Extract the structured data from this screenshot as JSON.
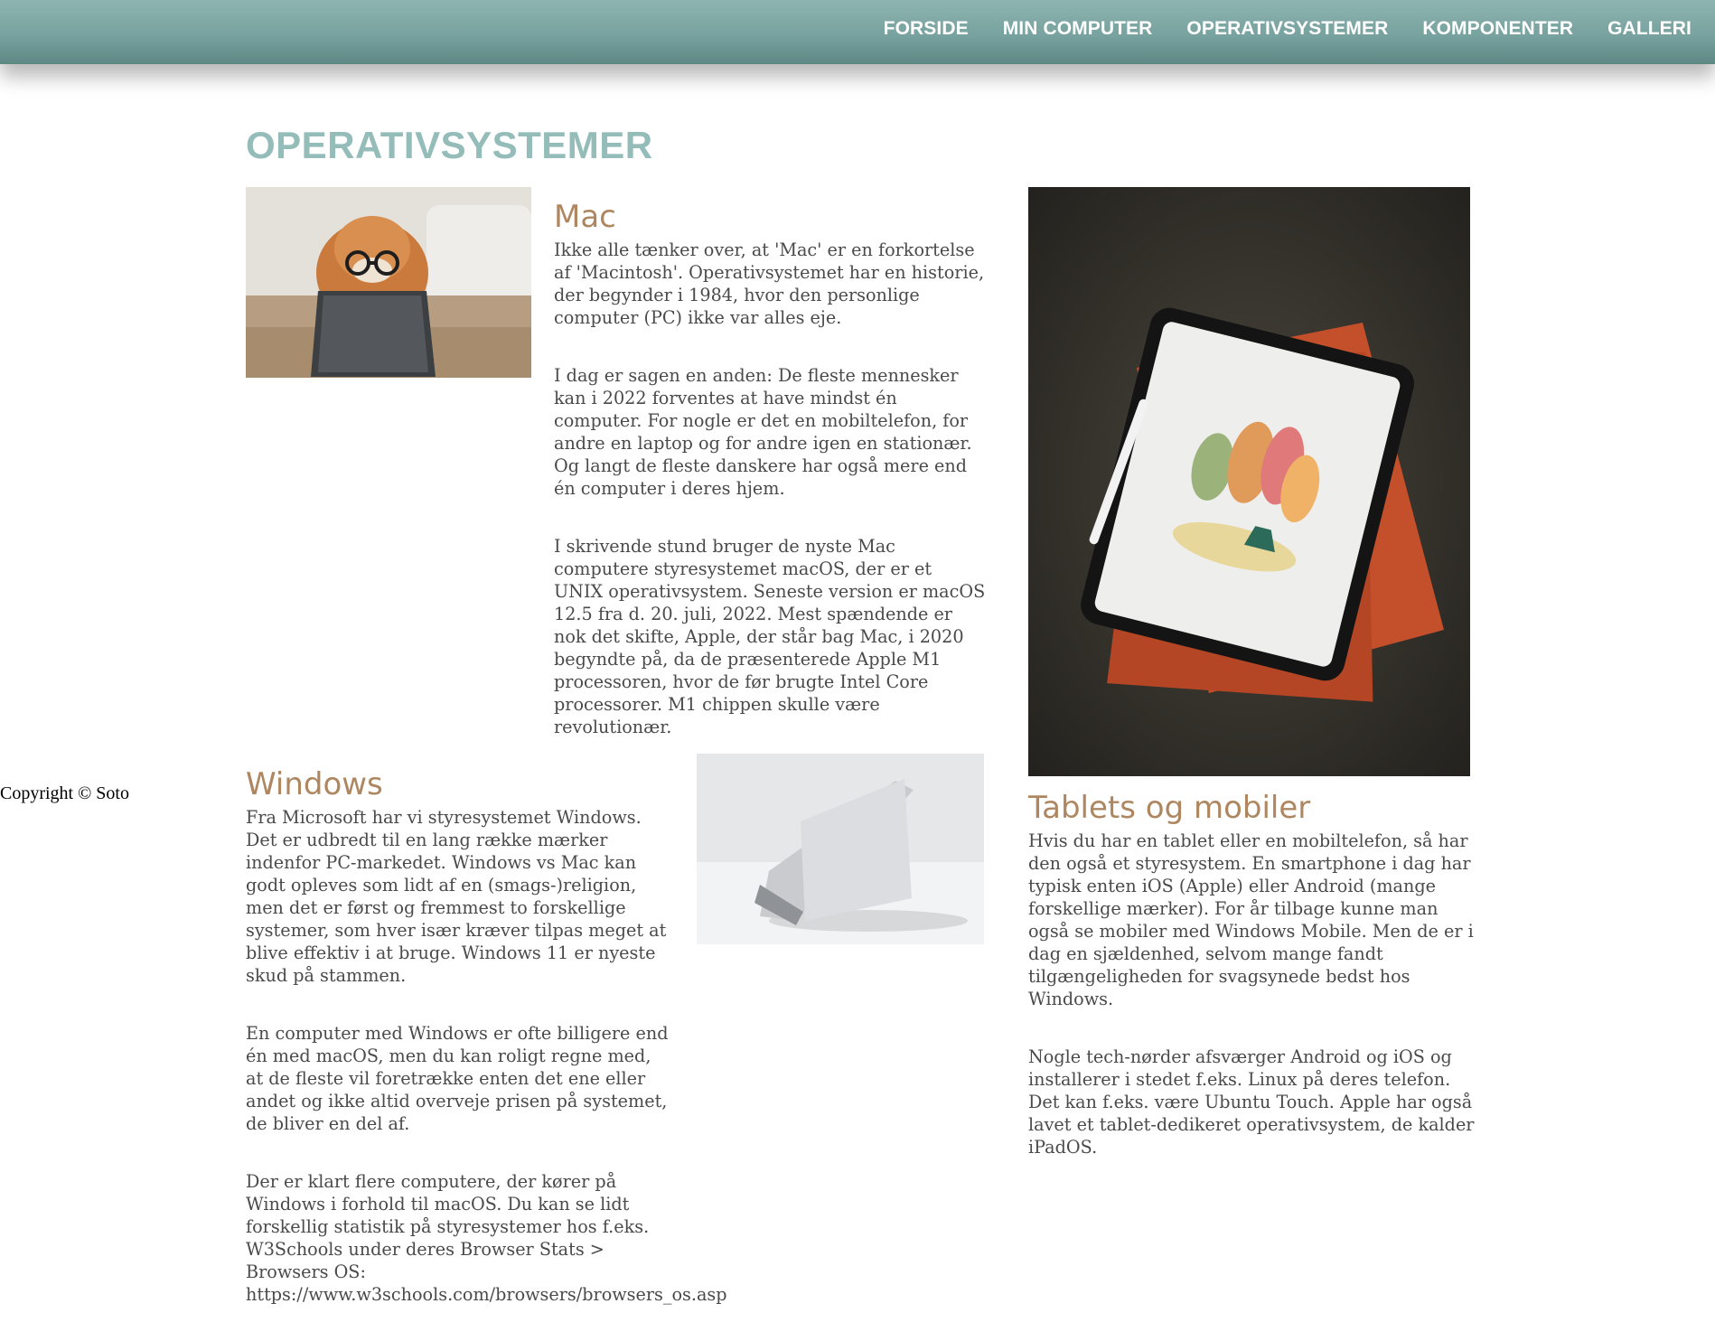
{
  "nav": {
    "items": [
      {
        "label": "FORSIDE"
      },
      {
        "label": "MIN COMPUTER"
      },
      {
        "label": "OPERATIVSYSTEMER"
      },
      {
        "label": "KOMPONENTER"
      },
      {
        "label": "GALLERI"
      }
    ]
  },
  "page": {
    "title": "OPERATIVSYSTEMER"
  },
  "sections": {
    "mac": {
      "heading": "Mac",
      "paragraphs": [
        "Ikke alle tænker over, at 'Mac' er en forkortelse af 'Macintosh'. Operativsystemet har en historie, der begynder i 1984, hvor den personlige computer (PC) ikke var alles eje.",
        "I dag er sagen en anden: De fleste mennesker kan i 2022 forventes at have mindst én computer. For nogle er det en mobiltelefon, for andre en laptop og for andre igen en stationær. Og langt de fleste danskere har også mere end én computer i deres hjem.",
        "I skrivende stund bruger de nyste Mac computere styresystemet macOS, der er et UNIX operativsystem. Seneste version er macOS 12.5 fra d. 20. juli, 2022. Mest spændende er nok det skifte, Apple, der står bag Mac, i 2020 begyndte på, da de præsenterede Apple M1 processoren, hvor de før brugte Intel Core processorer. M1 chippen skulle være revolutionær."
      ]
    },
    "windows": {
      "heading": "Windows",
      "paragraphs": [
        "Fra Microsoft har vi styresystemet Windows. Det er udbredt til en lang række mærker indenfor PC-markedet. Windows vs Mac kan godt opleves som lidt af en (smags-)religion, men det er først og fremmest to forskellige systemer, som hver især kræver tilpas meget at blive effektiv i at bruge. Windows 11 er nyeste skud på stammen.",
        "En computer med Windows er ofte billigere end én med macOS, men du kan roligt regne med, at de fleste vil foretrække enten det ene eller andet og ikke altid overveje prisen på systemet, de bliver en del af.",
        "Der er klart flere computere, der kører på Windows i forhold til macOS. Du kan se lidt forskellig statistik på styresystemer hos f.eks. W3Schools under deres Browser Stats > Browsers OS: https://www.w3schools.com/browsers/browsers_os.asp"
      ]
    },
    "tablets": {
      "heading": "Tablets og mobiler",
      "paragraphs": [
        "Hvis du har en tablet eller en mobiltelefon, så har den også et styresystem. En smartphone i dag har typisk enten iOS (Apple) eller Android (mange forskellige mærker). For år tilbage kunne man også se mobiler med Windows Mobile. Men de er i dag en sjældenhed, selvom mange fandt tilgængeligheden for svagsynede bedst hos Windows.",
        "Nogle tech-nørder afsværger Android og iOS og installerer i stedet f.eks. Linux på deres telefon. Det kan f.eks. være Ubuntu Touch. Apple har også lavet et tablet-dedikeret operativsystem, de kalder iPadOS."
      ]
    }
  },
  "footer": {
    "copyright": "Copyright © Soto"
  },
  "colors": {
    "nav_bg": "#7aa5a2",
    "title": "#94bcb8",
    "section_heading": "#ae8761",
    "body_text": "#4a4a4a"
  }
}
